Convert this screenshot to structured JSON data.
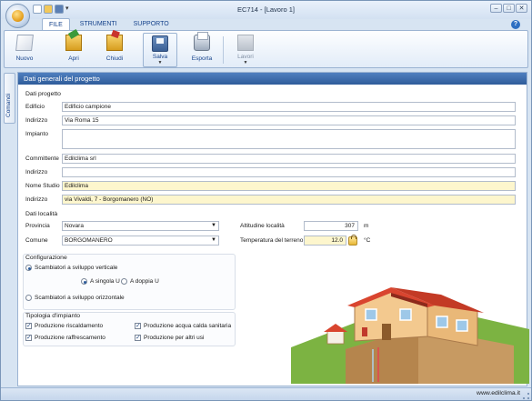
{
  "window": {
    "title": "EC714 - [Lavoro 1]"
  },
  "ribbon_tabs": [
    "FILE",
    "STRUMENTI",
    "SUPPORTO"
  ],
  "ribbon_buttons": {
    "new": "Nuovo",
    "open": "Apri",
    "close": "Chiudi",
    "save": "Salva",
    "export": "Esporta",
    "jobs": "Lavori"
  },
  "sidebar": {
    "tab_label": "Comandi"
  },
  "panel": {
    "header": "Dati generali del progetto"
  },
  "project": {
    "section_title": "Dati progetto",
    "labels": {
      "building": "Edificio",
      "address": "Indirizzo",
      "system": "Impianto",
      "client": "Committente",
      "client_address": "Indirizzo",
      "studio": "Nome Studio",
      "studio_address": "Indirizzo"
    },
    "values": {
      "building": "Edificio campione",
      "address": "Via Roma 15",
      "system": "",
      "client": "Edilclima srl",
      "client_address": "",
      "studio": "Edilclima",
      "studio_address": "via Vivaldi, 7 - Borgomanero (NO)"
    }
  },
  "location": {
    "section_title": "Dati località",
    "province_label": "Provincia",
    "province": "Novara",
    "town_label": "Comune",
    "town": "BORGOMANERO",
    "altitude_label": "Altitudine località",
    "altitude": "307",
    "altitude_unit": "m",
    "soil_temp_label": "Temperatura del terreno",
    "soil_temp": "12.0",
    "soil_temp_unit": "°C"
  },
  "configuration": {
    "section_title": "Configurazione",
    "vertical": "Scambiatori a sviluppo verticale",
    "single_u": "A singola U",
    "double_u": "A doppia U",
    "horizontal": "Scambiatori a sviluppo orizzontale",
    "selected_layout": "vertical",
    "selected_u": "single"
  },
  "system_type": {
    "section_title": "Tipologia d'impianto",
    "options": [
      {
        "label": "Produzione riscaldamento",
        "checked": true
      },
      {
        "label": "Produzione raffrescamento",
        "checked": true
      },
      {
        "label": "Produzione acqua calda sanitaria",
        "checked": true
      },
      {
        "label": "Produzione per altri usi",
        "checked": true
      }
    ]
  },
  "status": {
    "website": "www.edilclima.it"
  },
  "colors": {
    "accent": "#2f5c9a",
    "highlight_field": "#fdf6cd",
    "roof": "#d9452f",
    "wall": "#f3c98f"
  }
}
